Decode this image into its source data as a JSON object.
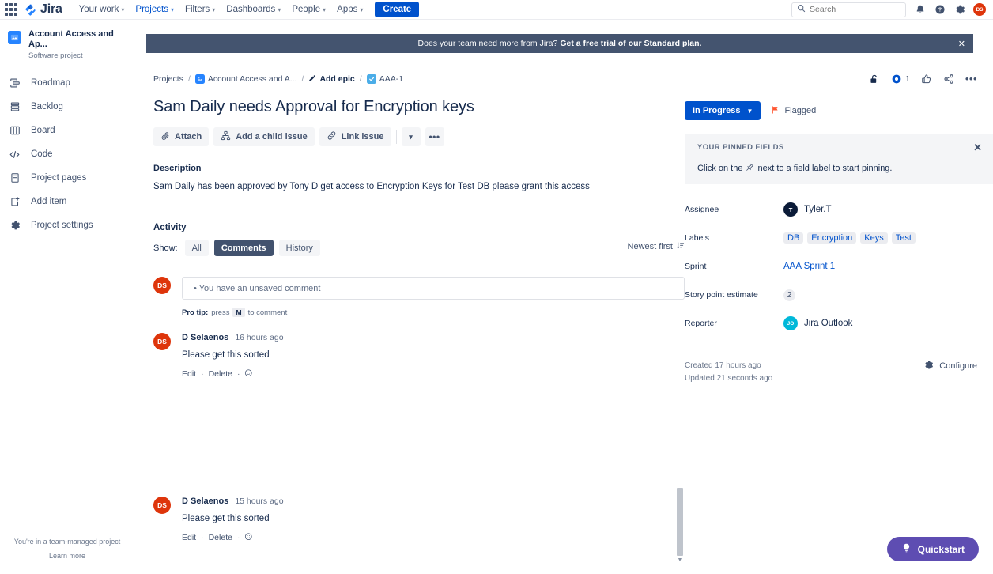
{
  "topnav": {
    "apps_icon": "apps-grid-icon",
    "logo_text": "Jira",
    "items": [
      {
        "label": "Your work",
        "has_caret": true,
        "active": false
      },
      {
        "label": "Projects",
        "has_caret": true,
        "active": true
      },
      {
        "label": "Filters",
        "has_caret": true,
        "active": false
      },
      {
        "label": "Dashboards",
        "has_caret": true,
        "active": false
      },
      {
        "label": "People",
        "has_caret": true,
        "active": false
      },
      {
        "label": "Apps",
        "has_caret": true,
        "active": false
      }
    ],
    "create_label": "Create",
    "search_placeholder": "Search",
    "notification_icon": "notifications-bell-icon",
    "help_icon": "help-question-icon",
    "settings_icon": "settings-gear-icon",
    "avatar_initials": "DS"
  },
  "sidebar": {
    "project_name": "Account Access and Ap...",
    "project_type": "Software project",
    "items": [
      {
        "label": "Roadmap",
        "icon": "roadmap-icon"
      },
      {
        "label": "Backlog",
        "icon": "backlog-icon"
      },
      {
        "label": "Board",
        "icon": "board-icon"
      },
      {
        "label": "Code",
        "icon": "code-icon"
      },
      {
        "label": "Project pages",
        "icon": "pages-icon"
      },
      {
        "label": "Add item",
        "icon": "add-item-icon"
      },
      {
        "label": "Project settings",
        "icon": "settings-gear-icon"
      }
    ],
    "footer_text": "You're in a team-managed project",
    "footer_link": "Learn more"
  },
  "banner": {
    "text": "Does your team need more from Jira?",
    "link": "Get a free trial of our Standard plan.",
    "close_icon": "close-x-icon"
  },
  "breadcrumb": {
    "projects": "Projects",
    "project": "Account Access and A...",
    "epic": "Add epic",
    "issue_key": "AAA-1"
  },
  "issue": {
    "title": "Sam Daily needs Approval for Encryption keys",
    "status": "In Progress",
    "flagged_label": "Flagged",
    "watch_count": "1"
  },
  "actions": {
    "attach": "Attach",
    "add_child": "Add a child issue",
    "link_issue": "Link issue",
    "chevron": "chevron-down-icon",
    "more": "more-options-icon"
  },
  "description": {
    "heading": "Description",
    "text": "Sam Daily has been approved by Tony D  get access to Encryption Keys for Test DB please grant this access"
  },
  "activity": {
    "heading": "Activity",
    "show_label": "Show:",
    "tabs": [
      {
        "label": "All",
        "selected": false
      },
      {
        "label": "Comments",
        "selected": true
      },
      {
        "label": "History",
        "selected": false
      }
    ],
    "sort_label": "Newest first"
  },
  "comment_input": {
    "avatar_initials": "DS",
    "value": "• You have an unsaved comment",
    "protip_prefix": "Pro tip:",
    "protip_press": "press",
    "protip_key": "M",
    "protip_suffix": "to comment"
  },
  "comments": [
    {
      "avatar_initials": "DS",
      "author": "D Selaenos",
      "time": "16 hours ago",
      "text": "Please get this sorted",
      "edit": "Edit",
      "delete": "Delete",
      "emoji_icon": "add-reaction-icon"
    },
    {
      "avatar_initials": "DS",
      "author": "D Selaenos",
      "time": "15 hours ago",
      "text": "Please get this sorted",
      "edit": "Edit",
      "delete": "Delete",
      "emoji_icon": "add-reaction-icon"
    }
  ],
  "right_panel": {
    "lock_icon": "unlocked-padlock-icon",
    "watch_icon": "watch-eye-icon",
    "vote_icon": "thumbs-up-icon",
    "share_icon": "share-icon",
    "more_icon": "more-options-icon",
    "pinned": {
      "title": "YOUR PINNED FIELDS",
      "desc_before": "Click on the",
      "pin_icon": "pin-icon",
      "desc_after": "next to a field label to start pinning.",
      "close_icon": "close-x-icon"
    },
    "fields": {
      "assignee_label": "Assignee",
      "assignee_value": "Tyler.T",
      "assignee_initials": "T",
      "labels_label": "Labels",
      "labels_values": [
        "DB",
        "Encryption",
        "Keys",
        "Test"
      ],
      "sprint_label": "Sprint",
      "sprint_value": "AAA Sprint 1",
      "story_points_label": "Story point estimate",
      "story_points_value": "2",
      "reporter_label": "Reporter",
      "reporter_value": "Jira Outlook",
      "reporter_initials": "JO"
    },
    "created": "Created 17 hours ago",
    "updated": "Updated 21 seconds ago",
    "configure": "Configure",
    "configure_icon": "settings-gear-icon"
  },
  "quickstart": {
    "label": "Quickstart",
    "icon": "lightbulb-icon"
  },
  "colors": {
    "brand_blue": "#0052CC",
    "banner_navy": "#44546F",
    "avatar_red": "#DE350B",
    "quickstart_purple": "#5E4DB2",
    "flag_red": "#FF5630",
    "reporter_teal": "#00B8D9",
    "selected_tab": "#42526E"
  }
}
